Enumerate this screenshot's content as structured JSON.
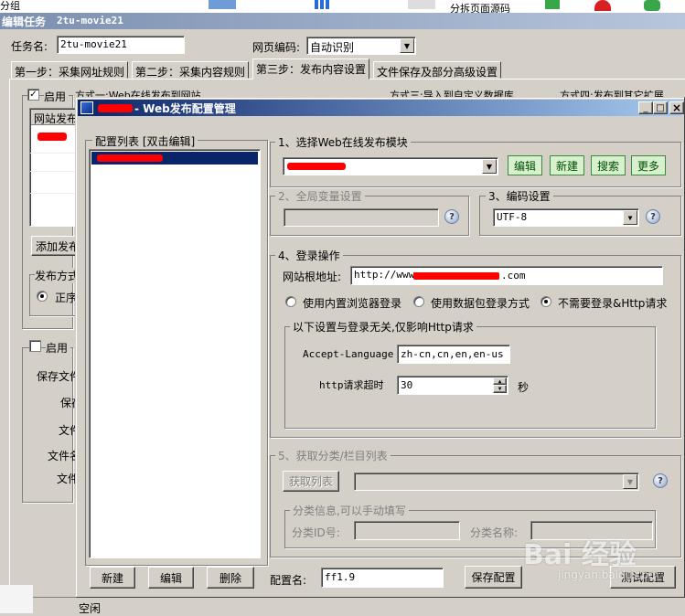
{
  "top_strip": {
    "left_text": "分组",
    "right_text": "分拆页面源码"
  },
  "outer": {
    "title_prefix": "编辑任务",
    "title_task": "2tu-movie21",
    "task_name_label": "任务名:",
    "task_name_value": "2tu-movie21",
    "encoding_label": "网页编码:",
    "encoding_value": "自动识别",
    "tabs": [
      "第一步：采集网址规则",
      "第二步：采集内容规则",
      "第三步：发布内容设置",
      "文件保存及部分高级设置"
    ],
    "enable1_label": "启用",
    "method1_label": "方式一:Web在线发布到网站",
    "method3_label": "方式三:导入到自定义数据库",
    "method4_label": "方式四:发布到其它扩展",
    "list_header": "网站发布",
    "add_button": "添加发布",
    "publish_label": "发布方式",
    "publish_option": "正序",
    "enable2_label": "启用",
    "save_file_label": "保存文件",
    "side_labels": [
      "保存",
      "文件",
      "文件名",
      "文件"
    ],
    "status_text": "空闲"
  },
  "dialog": {
    "title": "Web发布配置管理",
    "config_list_label": "配置列表 [双击编辑]",
    "sec1_label": "1、选择Web在线发布模块",
    "sec1_buttons": [
      "编辑",
      "新建",
      "搜索",
      "更多"
    ],
    "sec2_label": "2、全局变量设置",
    "sec3_label": "3、编码设置",
    "encoding_value": "UTF-8",
    "sec4_label": "4、登录操作",
    "root_label": "网站根地址:",
    "root_prefix": "http://www.",
    "root_suffix": ".com",
    "login_options": [
      "使用内置浏览器登录",
      "使用数据包登录方式",
      "不需要登录&Http请求"
    ],
    "login_selected": 2,
    "http_group_label": "以下设置与登录无关,仅影响Http请求",
    "accept_language_label": "Accept-Language",
    "accept_language_value": "zh-cn,cn,en,en-us",
    "timeout_label": "http请求超时",
    "timeout_value": "30",
    "timeout_unit": "秒",
    "sec5_label": "5、获取分类/栏目列表",
    "get_list_button": "获取列表",
    "category_group_label": "分类信息,可以手动填写",
    "category_id_label": "分类ID号:",
    "category_name_label": "分类名称:",
    "bottom_buttons": [
      "新建",
      "编辑",
      "删除"
    ],
    "config_name_label": "配置名:",
    "config_name_value": "ff1.9",
    "save_config_button": "保存配置",
    "test_config_button": "测试配置",
    "window_controls": [
      "_",
      "□",
      "×"
    ]
  },
  "watermark": {
    "text": "Bai 经验",
    "sub": "jingyan.baidu.com"
  }
}
